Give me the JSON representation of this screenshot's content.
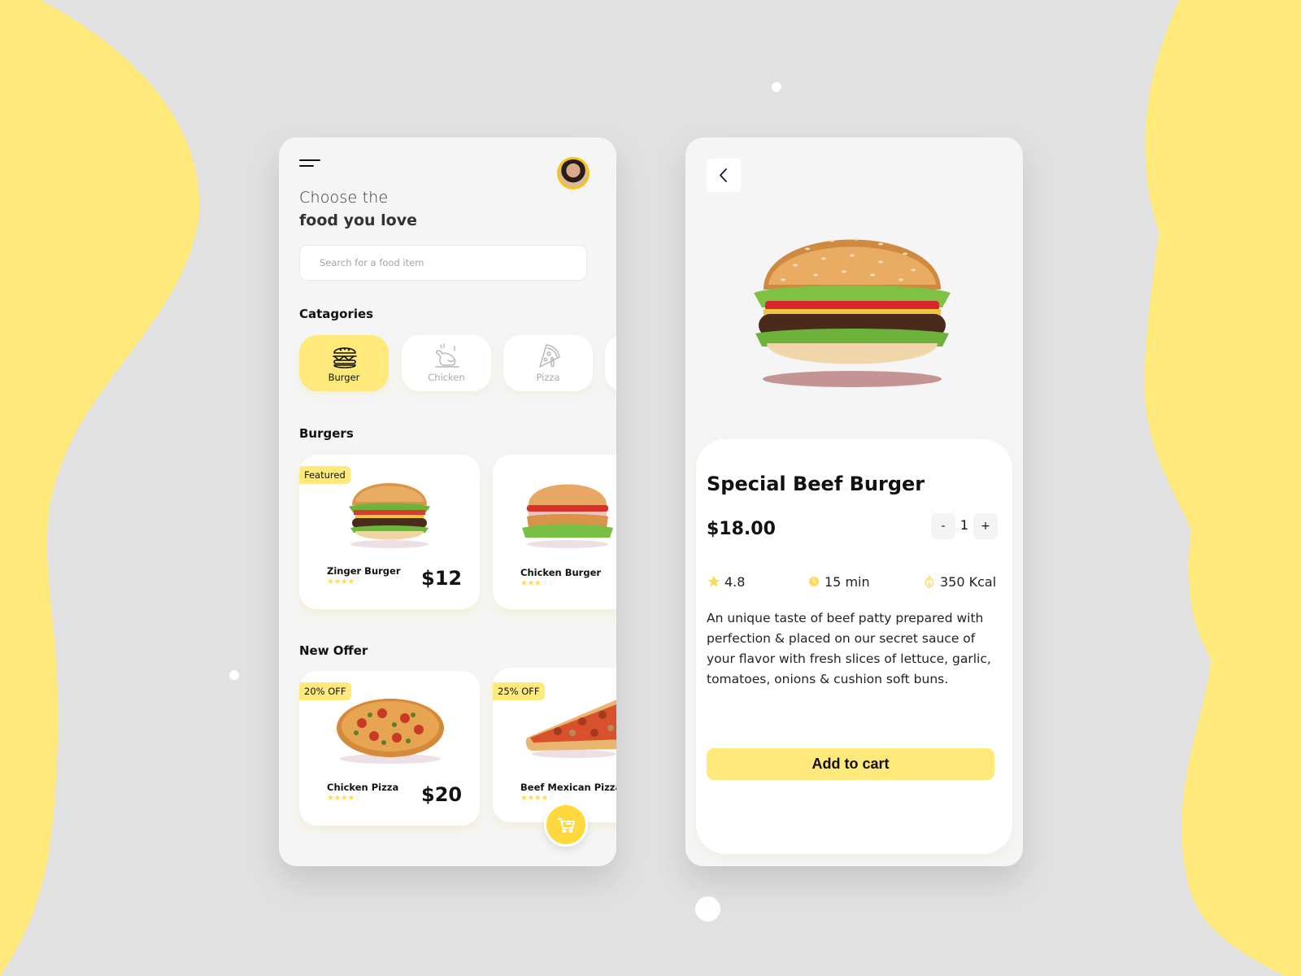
{
  "theme": {
    "accent": "#ffe97a",
    "accent_strong": "#ffd83d",
    "background": "#e1e1e1",
    "blob": "#ffe97a"
  },
  "list_screen": {
    "menu_icon": "hamburger-menu-icon",
    "avatar_icon": "user-avatar",
    "headline_light": "Choose the",
    "headline_bold": "food you love",
    "search": {
      "placeholder": "Search for a food item",
      "value": ""
    },
    "categories_title": "Catagories",
    "categories": [
      {
        "label": "Burger",
        "icon": "burger-icon",
        "active": true
      },
      {
        "label": "Chicken",
        "icon": "roast-chicken-icon",
        "active": false
      },
      {
        "label": "Pizza",
        "icon": "pizza-slice-icon",
        "active": false
      }
    ],
    "burgers_title": "Burgers",
    "burgers": [
      {
        "badge": "Featured",
        "name": "Zinger Burger",
        "price": "$12",
        "rating": 4,
        "max_rating": 5
      },
      {
        "badge": "",
        "name": "Chicken Burger",
        "price": "",
        "rating": 3,
        "max_rating": 5
      }
    ],
    "offers_title": "New Offer",
    "offers": [
      {
        "badge": "20% OFF",
        "name": "Chicken Pizza",
        "price": "$20",
        "rating": 4,
        "max_rating": 5
      },
      {
        "badge": "25% OFF",
        "name": "Beef Mexican Pizza",
        "price": "",
        "rating": 4,
        "max_rating": 5
      }
    ],
    "cart_icon": "shopping-cart-icon"
  },
  "detail_screen": {
    "back_icon": "chevron-left-icon",
    "title": "Special Beef Burger",
    "price": "$18.00",
    "quantity": {
      "minus": "-",
      "value": "1",
      "plus": "+"
    },
    "rating": "4.8",
    "time": "15 min",
    "calories": "350 Kcal",
    "description": "An unique taste of beef patty prepared with perfection & placed on our secret sauce of your flavor with fresh slices of lettuce, garlic, tomatoes, onions & cushion soft buns.",
    "add_to_cart_label": "Add to cart"
  }
}
